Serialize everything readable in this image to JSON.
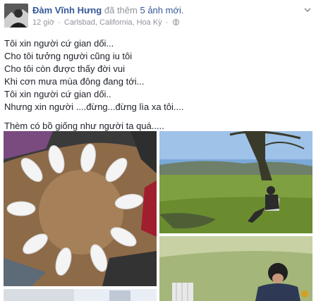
{
  "post": {
    "author_name": "Đàm Vĩnh Hưng",
    "action_text": "đã thêm",
    "photo_count_text": "5 ảnh mới.",
    "time": "12 giờ",
    "separator": "·",
    "location": "Carlsbad, California, Hoa Kỳ",
    "privacy_icon": "globe-icon",
    "menu_icon": "chevron-down-icon"
  },
  "body": {
    "lines": [
      "Tôi xin người cứ gian dối...",
      "Cho tôi tưởng người cũng iu tôi",
      "Cho tôi còn được thấy đời vui",
      "Khi cơn mưa mùa đông đang tới...",
      "Tôi xin người cứ gian dối..",
      "Nhưng xin người ....đừng...đừng lìa xa tôi...."
    ],
    "last_line": "Thèm có bồ giống như người ta quá....."
  },
  "colors": {
    "link": "#365899",
    "meta": "#90949c",
    "text": "#1d2129"
  }
}
